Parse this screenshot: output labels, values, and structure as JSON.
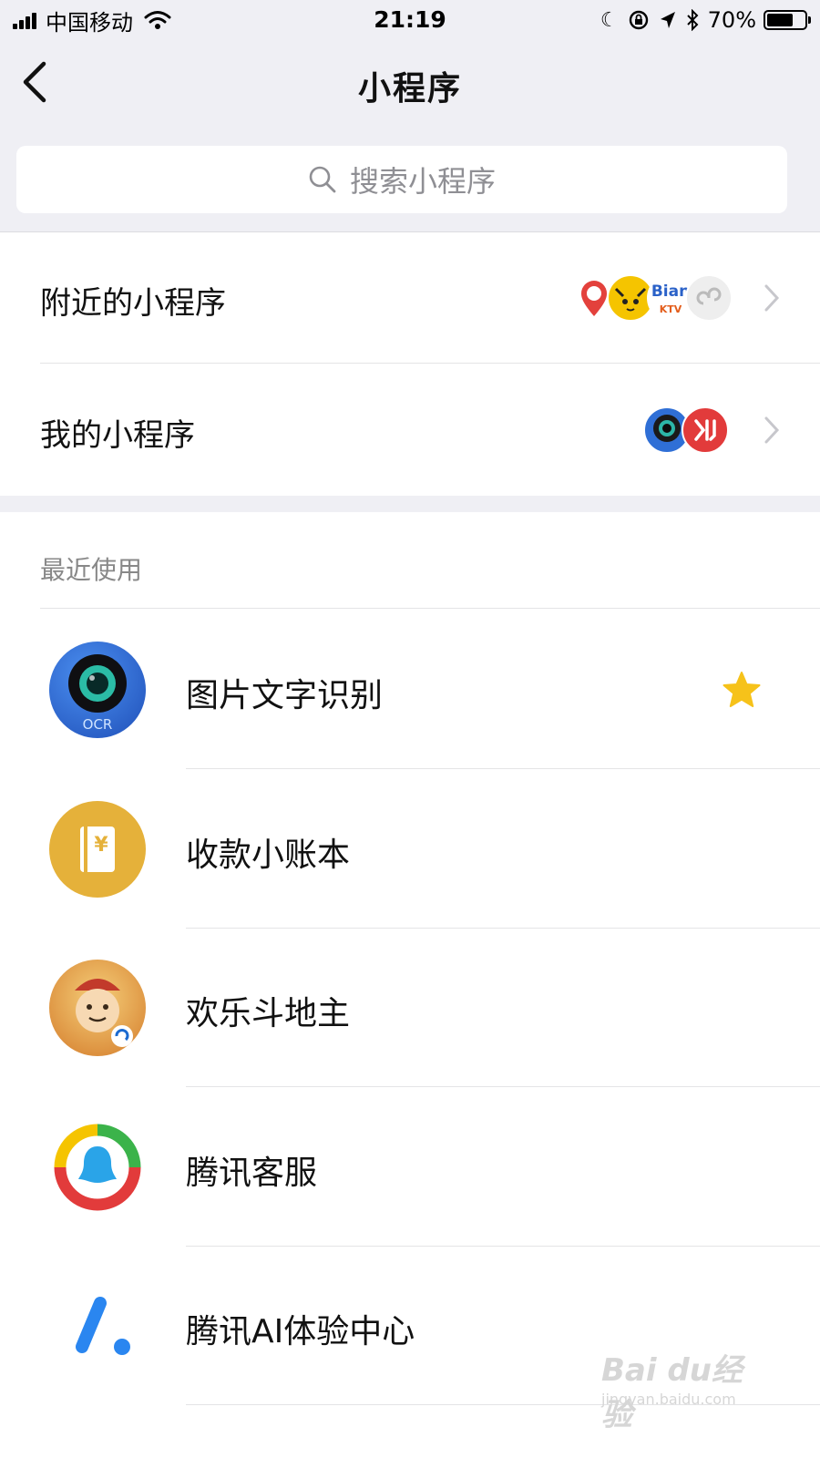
{
  "status_bar": {
    "carrier": "中国移动",
    "time": "21:19",
    "battery_percent": "70%",
    "battery_level": 0.7
  },
  "nav": {
    "title": "小程序"
  },
  "search": {
    "placeholder": "搜索小程序"
  },
  "rows": [
    {
      "label": "附近的小程序"
    },
    {
      "label": "我的小程序"
    }
  ],
  "recent": {
    "heading": "最近使用",
    "items": [
      {
        "name": "图片文字识别",
        "icon": "ocr-icon",
        "starred": true,
        "icon_text": "OCR"
      },
      {
        "name": "收款小账本",
        "icon": "ledger-icon",
        "icon_text": "¥"
      },
      {
        "name": "欢乐斗地主",
        "icon": "doudizhu-icon"
      },
      {
        "name": "腾讯客服",
        "icon": "tencent-service-icon"
      },
      {
        "name": "腾讯AI体验中心",
        "icon": "tencent-ai-icon"
      }
    ]
  },
  "nearby_thumbs": {
    "b_text": "Bian",
    "b_sub": "KTV"
  },
  "watermark": {
    "main": "Bai du经验",
    "sub": "jingyan.baidu.com"
  },
  "colors": {
    "accent_star": "#f6c21a",
    "nav_bg": "#efeff4",
    "ocr_blue": "#2f6fd6",
    "ledger_gold": "#e5b13a"
  }
}
